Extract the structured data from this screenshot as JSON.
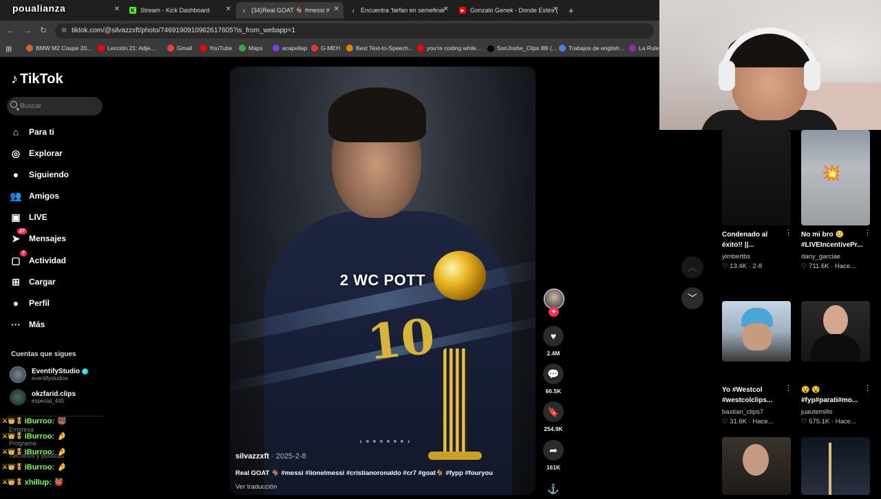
{
  "browser": {
    "tabs": [
      {
        "label": "poualianza",
        "favicon_color": "#53fc18",
        "active": false
      },
      {
        "label": "Stream - Kick Dashboard",
        "favicon_color": "#53fc18",
        "active": false
      },
      {
        "label": "(34)Real GOAT 🐐 #messi #",
        "favicon_color": "#000000",
        "active": true
      },
      {
        "label": "Encuentra 'farfan en semefinal",
        "favicon_color": "#000000",
        "active": false
      },
      {
        "label": "Gonzalo Genek - Donde Estés (",
        "favicon_color": "#ff0000",
        "active": false
      }
    ],
    "new_tab_label": "+",
    "url": "tiktok.com/@silvazzxft/photo/7469190910962617605?is_from_webapp=1",
    "bookmarks": [
      {
        "label": "BMW M2 Coupe 20...",
        "color": "#e05a2a"
      },
      {
        "label": "Lección 21: Adje...",
        "color": "#ff0000"
      },
      {
        "label": "Gmail",
        "color": "#ea4335"
      },
      {
        "label": "YouTube",
        "color": "#ff0000"
      },
      {
        "label": "Maps",
        "color": "#34a853"
      },
      {
        "label": "acapellap",
        "color": "#7b3fe4"
      },
      {
        "label": "G-MEH",
        "color": "#e53935"
      },
      {
        "label": "Best Text-to-Speech...",
        "color": "#f57c00"
      },
      {
        "label": "you're coding while...",
        "color": "#ff0000"
      },
      {
        "label": "SonJoshe_Clips 🎟 (...",
        "color": "#000000"
      },
      {
        "label": "Trabajos de english...",
        "color": "#4285f4"
      },
      {
        "label": "La Ruleta",
        "color": "#9c27b0"
      }
    ]
  },
  "overlay_title": "poualianza",
  "sidebar": {
    "logo": "TikTok",
    "search_placeholder": "Buscar",
    "items": [
      {
        "label": "Para ti",
        "icon": "home-icon",
        "glyph": "⌂"
      },
      {
        "label": "Explorar",
        "icon": "compass-icon",
        "glyph": "◎"
      },
      {
        "label": "Siguiendo",
        "icon": "following-icon",
        "glyph": "●"
      },
      {
        "label": "Amigos",
        "icon": "friends-icon",
        "glyph": "👥"
      },
      {
        "label": "LIVE",
        "icon": "live-icon",
        "glyph": "▣"
      },
      {
        "label": "Mensajes",
        "icon": "messages-icon",
        "glyph": "➤",
        "badge": "27"
      },
      {
        "label": "Actividad",
        "icon": "activity-icon",
        "glyph": "▢",
        "badge": "7"
      },
      {
        "label": "Cargar",
        "icon": "upload-icon",
        "glyph": "⊞"
      },
      {
        "label": "Perfil",
        "icon": "profile-icon",
        "glyph": "●"
      },
      {
        "label": "Más",
        "icon": "more-icon",
        "glyph": "···"
      }
    ],
    "following_title": "Cuentas que sigues",
    "following": [
      {
        "name": "EventifyStudio",
        "handle": "eventifystudios",
        "verified": true
      },
      {
        "name": "okzfarid.clips",
        "handle": "especial_445",
        "verified": false
      }
    ],
    "footer": [
      "Empresa",
      "Programa",
      "Términos y políticas"
    ]
  },
  "chat": [
    {
      "user": "iBurroo:",
      "msg": "🐻"
    },
    {
      "user": "iBurroo:",
      "msg": "🤌"
    },
    {
      "user": "iBurroo:",
      "msg": "🤌"
    },
    {
      "user": "iBurroo:",
      "msg": "🤌"
    },
    {
      "user": "xhillup:",
      "msg": "👹"
    }
  ],
  "video": {
    "caption": "2 WC POTT",
    "author": "silvazzxft",
    "date": "· 2025-2-8",
    "description": "Real GOAT 🐐 #messi #lionelmessi #cristianoronaldo #cr7 #goat🐐 #fypp #fouryou",
    "translate": "Ver traducción",
    "jersey_number": "10",
    "likes": "2.4M",
    "comments": "66.5K",
    "saves": "254.9K",
    "shares": "161K"
  },
  "grid": [
    {
      "title": "Condenado al éxito!! ||...",
      "author": "yimbertbs",
      "stats": "♡ 13.4K · 2-8"
    },
    {
      "title": "No mi bro 🥲 #LIVEIncentivePr...",
      "author": "dany_garciae",
      "stats": "♡ 711.6K · Hace..."
    },
    {
      "title": "Yo #Westcol #westcolclips...",
      "author": "bastian_clips7",
      "stats": "♡ 31.6K · Hace..."
    },
    {
      "title": "😵 😵 #fyp#parati#mo...",
      "author": "juautemillo",
      "stats": "♡ 575.1K · Hace..."
    }
  ],
  "colors": {
    "accent": "#fe2c55",
    "chat_user": "#7cff4f",
    "trophy": "#e8b420"
  }
}
